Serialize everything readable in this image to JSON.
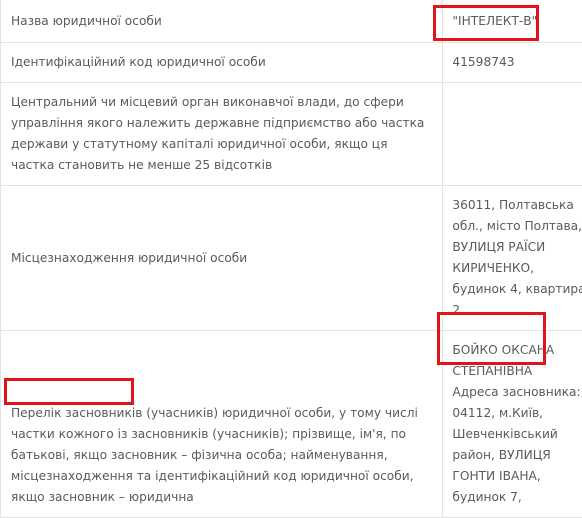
{
  "rows": [
    {
      "label": "Назва юридичної особи",
      "value": "\"ІНТЕЛЕКТ-В\""
    },
    {
      "label": "Ідентифікаційний код юридичної особи",
      "value": "41598743"
    },
    {
      "label": "Центральний чи місцевий орган виконавчої влади, до сфери управління якого належить державне підприємство або частка держави у статутному капіталі юридичної особи, якщо ця частка становить не менше 25 відсотків",
      "value": ""
    },
    {
      "label": "Місцезнаходження юридичної особи",
      "value": "36011, Полтавська обл., місто Полтава, ВУЛИЦЯ РАЇСИ КИРИЧЕНКО, будинок 4, квартира 2"
    },
    {
      "label_highlight": "Перелік засновників",
      "label": " (учасників) юридичної особи, у тому числі частки кожного із засновників (учасників); прізвище, ім'я, по батькові, якщо засновник – фізична особа; найменування, місцезнаходження та ідентифікаційний код юридичної особи, якщо засновник – юридична",
      "value_name": "БОЙКО ОКСАНА СТЕПАНІВНА",
      "value": "Адреса засновника: 04112, м.Київ, Шевченківський район, ВУЛИЦЯ ГОНТИ ІВАНА, будинок 7,"
    }
  ],
  "highlight_color": "#e0141b"
}
